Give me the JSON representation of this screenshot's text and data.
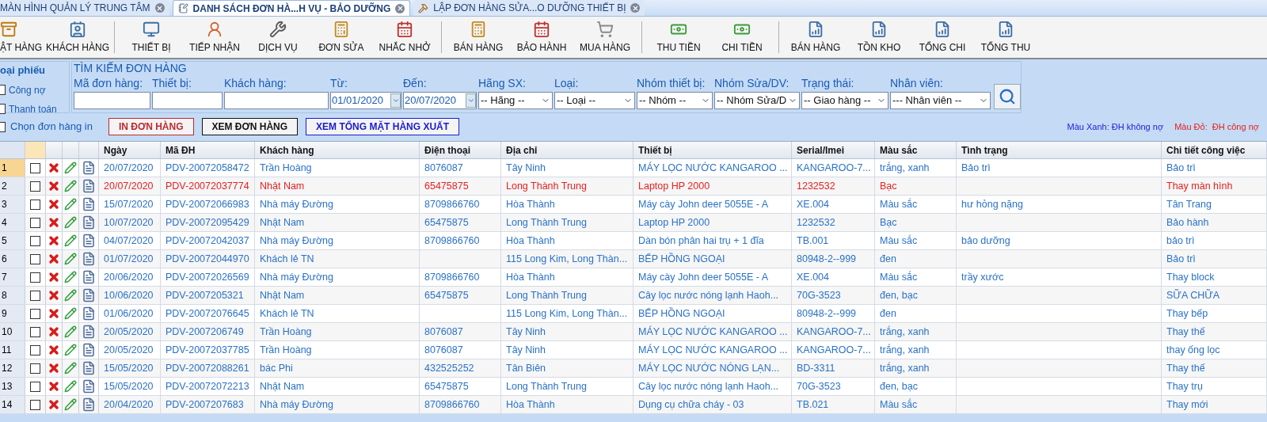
{
  "tabs": [
    {
      "label": "MÀN HÌNH QUẢN LÝ TRUNG TÂM",
      "selected": false
    },
    {
      "label": "DANH SÁCH ĐƠN HÀ...H VỤ - BẢO DƯỠNG",
      "selected": true
    },
    {
      "label": "LẬP ĐƠN HÀNG SỬA...O DƯỠNG THIẾT BỊ",
      "selected": false
    }
  ],
  "toolbar": [
    [
      "ẬT HÀNG",
      "KHÁCH HÀNG"
    ],
    [
      "THIẾT BỊ",
      "TIẾP NHẬN",
      "DỊCH VỤ",
      "ĐƠN SỬA",
      "NHẮC NHỞ"
    ],
    [
      "BÁN HÀNG",
      "BẢO HÀNH",
      "MUA HÀNG"
    ],
    [
      "THU TIỀN",
      "CHI TIỀN"
    ],
    [
      "BÁN HÀNG",
      "TỒN KHO",
      "TỔNG CHI",
      "TỔNG THU"
    ]
  ],
  "voucher_type": {
    "title": "oại phiếu",
    "options": [
      {
        "label": "Công nợ",
        "checked": false
      },
      {
        "label": "Thanh toán",
        "checked": false
      }
    ]
  },
  "search": {
    "title": "TÌM KIẾM ĐƠN HÀNG",
    "fields": [
      {
        "kind": "text",
        "label": "Mã đơn hàng:"
      },
      {
        "kind": "text",
        "label": "Thiết bị:"
      },
      {
        "kind": "text",
        "label": "Khách hàng:"
      },
      {
        "kind": "date",
        "label": "Từ:",
        "value": "01/01/2020"
      },
      {
        "kind": "date",
        "label": "Đến:",
        "value": "20/07/2020"
      },
      {
        "kind": "select",
        "label": "Hãng SX:",
        "value": "-- Hãng --"
      },
      {
        "kind": "select",
        "label": "Loại:",
        "value": "-- Loại --"
      },
      {
        "kind": "select",
        "label": "Nhóm thiết bị:",
        "value": "-- Nhóm --"
      },
      {
        "kind": "select",
        "label": "Nhóm Sửa/DV:",
        "value": "-- Nhóm Sửa/D"
      },
      {
        "kind": "select",
        "label": "Trạng thái:",
        "value": "-- Giao hàng --"
      },
      {
        "kind": "select",
        "label": "Nhân viên:",
        "value": "--- Nhân viên --"
      }
    ]
  },
  "select_print": {
    "label": "Chọn đơn hàng in",
    "checked": false
  },
  "actions": [
    {
      "label": "IN ĐƠN HÀNG",
      "color": "#c0282d"
    },
    {
      "label": "XEM ĐƠN HÀNG",
      "color": "#111111"
    },
    {
      "label": "XEM TỔNG MẶT HÀNG XUẤT",
      "color": "#1a1ad0"
    }
  ],
  "legend": [
    {
      "label": "Màu Xanh: ĐH không nợ",
      "color": "#1a1ae0"
    },
    {
      "label": "Màu Đỏ:  ĐH công nợ",
      "color": "#e02020"
    }
  ],
  "table": {
    "columns": [
      "Ngày",
      "Mã ĐH",
      "Khách hàng",
      "Điện thoại",
      "Địa chỉ",
      "Thiết bị",
      "Serial/Imei",
      "Màu sắc",
      "Tình trạng",
      "Chi tiết công việc"
    ],
    "rows": [
      {
        "no": "1",
        "selected": true,
        "checked": false,
        "debt": false,
        "date": "20/07/2020",
        "code": "PDV-20072058472",
        "customer": "Trần Hoàng",
        "phone": "8076087",
        "address": "Tây Ninh",
        "device": "MÁY LỌC NƯỚC KANGAROO ...",
        "serial": "KANGAROO-7...",
        "finish": "trắng, xanh",
        "condition": "Bảo trì",
        "detail": "Bảo trì"
      },
      {
        "no": "2",
        "selected": false,
        "checked": false,
        "debt": true,
        "date": "20/07/2020",
        "code": "PDV-20072037774",
        "customer": "Nhật Nam",
        "phone": "65475875",
        "address": "Long Thành Trung",
        "device": "Laptop HP 2000",
        "serial": "1232532",
        "finish": "Bạc",
        "detail": "Thay màn hình"
      },
      {
        "no": "3",
        "selected": false,
        "checked": false,
        "debt": false,
        "date": "15/07/2020",
        "code": "PDV-20072066983",
        "customer": "Nhà máy Đường",
        "phone": "8709866760",
        "address": "Hòa Thành",
        "device": "Máy cày John deer 5055E - A",
        "serial": "XE.004",
        "finish": "Màu sắc",
        "condition": "hư hỏng nặng",
        "detail": "Tân Trang"
      },
      {
        "no": "4",
        "selected": false,
        "checked": false,
        "debt": false,
        "date": "10/07/2020",
        "code": "PDV-20072095429",
        "customer": "Nhật Nam",
        "phone": "65475875",
        "address": "Long Thành Trung",
        "device": "Laptop HP 2000",
        "serial": "1232532",
        "finish": "Bạc",
        "detail": "Bảo hành"
      },
      {
        "no": "5",
        "selected": false,
        "checked": false,
        "debt": false,
        "date": "04/07/2020",
        "code": "PDV-20072042037",
        "customer": "Nhà máy Đường",
        "phone": "8709866760",
        "address": "Hòa Thành",
        "device": "Dàn bón phân hai trụ + 1 đĩa",
        "serial": "TB.001",
        "finish": "Màu sắc",
        "condition": "bảo dưỡng",
        "detail": "bảo trì"
      },
      {
        "no": "6",
        "selected": false,
        "checked": false,
        "debt": false,
        "date": "01/07/2020",
        "code": "PDV-20072044970",
        "customer": "Khách lẻ TN",
        "address": "115 Long Kim, Long Thàn...",
        "device": "BẾP HỒNG NGOẠI",
        "serial": "80948-2--999",
        "finish": "đen",
        "detail": "Bảo trì"
      },
      {
        "no": "7",
        "selected": false,
        "checked": false,
        "debt": false,
        "date": "20/06/2020",
        "code": "PDV-20072026569",
        "customer": "Nhà máy Đường",
        "phone": "8709866760",
        "address": "Hòa Thành",
        "device": "Máy cày John deer 5055E - A",
        "serial": "XE.004",
        "finish": "Màu sắc",
        "condition": "trầy xước",
        "detail": "Thay block"
      },
      {
        "no": "8",
        "selected": false,
        "checked": false,
        "debt": false,
        "date": "10/06/2020",
        "code": "PDV-2007205321",
        "customer": "Nhật Nam",
        "phone": "65475875",
        "address": "Long Thành Trung",
        "device": "Cây lọc nước nóng lạnh Haoh...",
        "serial": "70G-3523",
        "finish": "đen, bạc",
        "detail": "SỮA CHỮA"
      },
      {
        "no": "9",
        "selected": false,
        "checked": false,
        "debt": false,
        "date": "01/06/2020",
        "code": "PDV-20072076645",
        "customer": "Khách lẻ TN",
        "address": "115 Long Kim, Long Thàn...",
        "device": "BẾP HỒNG NGOẠI",
        "serial": "80948-2--999",
        "finish": "đen",
        "detail": "Thay bếp"
      },
      {
        "no": "10",
        "selected": false,
        "checked": false,
        "debt": false,
        "date": "20/05/2020",
        "code": "PDV-2007206749",
        "customer": "Trần Hoàng",
        "phone": "8076087",
        "address": "Tây Ninh",
        "device": "MÁY LỌC NƯỚC KANGAROO ...",
        "serial": "KANGAROO-7...",
        "finish": "trắng, xanh",
        "detail": "Thay thế"
      },
      {
        "no": "11",
        "selected": false,
        "checked": false,
        "debt": false,
        "date": "20/05/2020",
        "code": "PDV-20072037785",
        "customer": "Trần Hoàng",
        "phone": "8076087",
        "address": "Tây Ninh",
        "device": "MÁY LỌC NƯỚC KANGAROO ...",
        "serial": "KANGAROO-7...",
        "finish": "trắng, xanh",
        "detail": "thay ống lọc"
      },
      {
        "no": "12",
        "selected": false,
        "checked": false,
        "debt": false,
        "date": "15/05/2020",
        "code": "PDV-20072088261",
        "customer": "bác Phi",
        "phone": "432525252",
        "address": "Tân Biên",
        "device": "MÁY LỌC NƯỚC NÓNG LẠN...",
        "serial": "BD-3311",
        "finish": "trắng, xanh",
        "detail": "Thay thế"
      },
      {
        "no": "13",
        "selected": false,
        "checked": false,
        "debt": false,
        "date": "15/05/2020",
        "code": "PDV-20072072213",
        "customer": "Nhật Nam",
        "phone": "65475875",
        "address": "Long Thành Trung",
        "device": "Cây lọc nước nóng lạnh Haoh...",
        "serial": "70G-3523",
        "finish": "đen, bạc",
        "detail": "Thay trụ"
      },
      {
        "no": "14",
        "selected": false,
        "checked": false,
        "debt": false,
        "date": "20/04/2020",
        "code": "PDV-2007207683",
        "customer": "Nhà máy Đường",
        "phone": "8709866760",
        "address": "Hòa Thành",
        "device": "Dụng cụ chữa cháy - 03",
        "serial": "TB.021",
        "finish": "Màu sắc",
        "detail": "Thay mới"
      }
    ]
  }
}
